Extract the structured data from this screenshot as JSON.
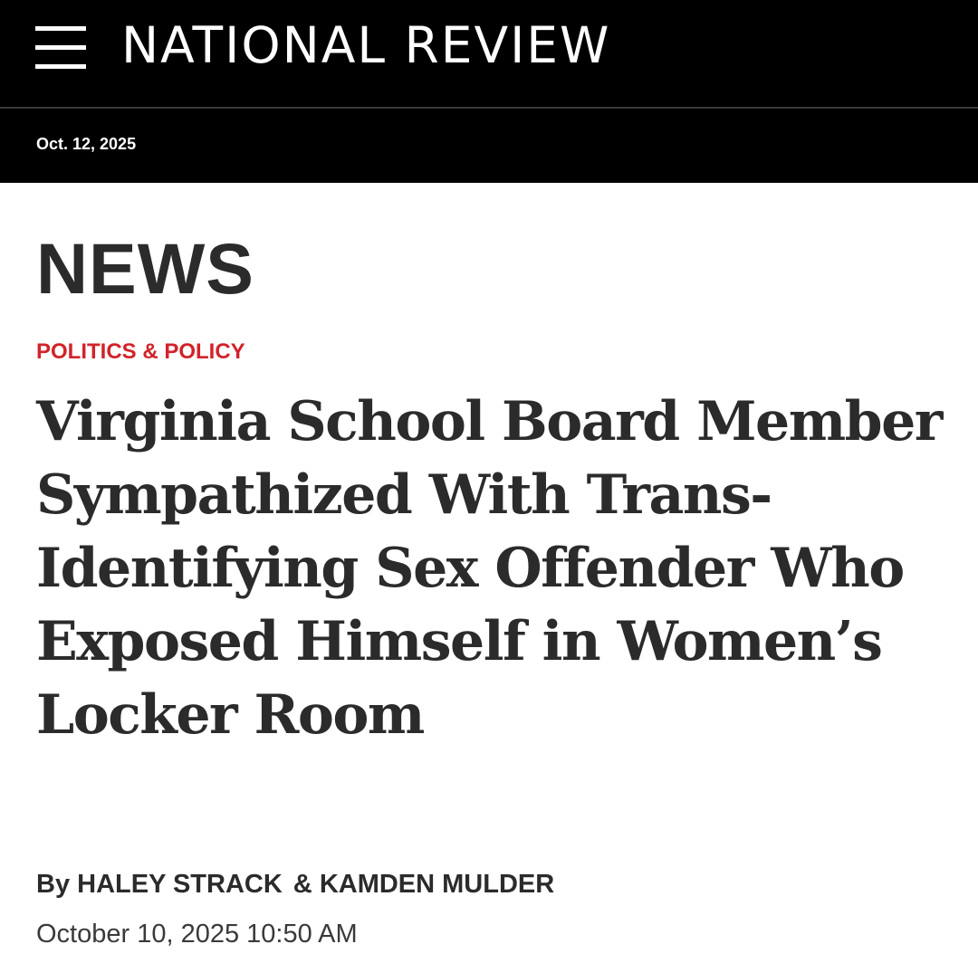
{
  "header": {
    "brand": "NATIONAL REVIEW",
    "menu_icon": "hamburger-menu-icon",
    "date": "Oct. 12, 2025"
  },
  "article": {
    "section": "NEWS",
    "category": "POLITICS & POLICY",
    "headline": "Virginia School Board Member Sympathized With Trans-Identifying Sex Offender Who Exposed Himself in Women’s Locker Room",
    "byline": {
      "prefix": "By",
      "author1": "HALEY STRACK",
      "separator": "&",
      "author2": "KAMDEN MULDER"
    },
    "timestamp": "October 10, 2025 10:50 AM"
  },
  "colors": {
    "header_background": "#000000",
    "category_red": "#d2232a",
    "text_dark": "#2b2b2b"
  }
}
